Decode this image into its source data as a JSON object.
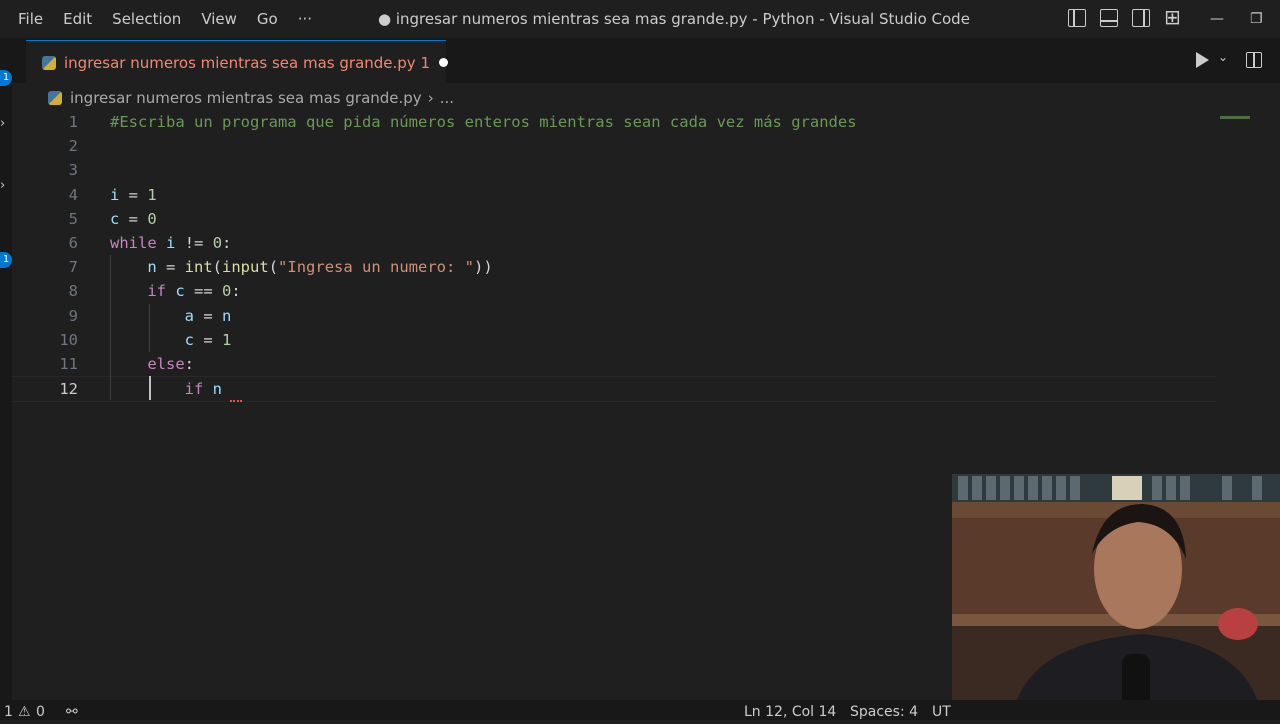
{
  "menu": [
    "File",
    "Edit",
    "Selection",
    "View",
    "Go",
    "···"
  ],
  "window": {
    "title": "● ingresar numeros mientras sea mas grande.py - Python - Visual Studio Code",
    "minimize": "—",
    "restore": "❐"
  },
  "activity_badges": [
    "1",
    "1"
  ],
  "tab": {
    "label": "ingresar numeros mientras sea mas grande.py 1"
  },
  "breadcrumb": {
    "file": "ingresar numeros mientras sea mas grande.py",
    "sep": "›",
    "more": "..."
  },
  "editor": {
    "active_line": 12,
    "lines": [
      {
        "n": "1",
        "segments": [
          {
            "t": "#Escriba un programa que pida números enteros mientras sean cada vez más grandes",
            "c": "cmt"
          }
        ]
      },
      {
        "n": "2",
        "segments": []
      },
      {
        "n": "3",
        "segments": []
      },
      {
        "n": "4",
        "segments": [
          {
            "t": "i",
            "c": "var"
          },
          {
            "t": " = ",
            "c": ""
          },
          {
            "t": "1",
            "c": "num"
          }
        ]
      },
      {
        "n": "5",
        "segments": [
          {
            "t": "c",
            "c": "var"
          },
          {
            "t": " = ",
            "c": ""
          },
          {
            "t": "0",
            "c": "num"
          }
        ]
      },
      {
        "n": "6",
        "segments": [
          {
            "t": "while",
            "c": "kw"
          },
          {
            "t": " ",
            "c": ""
          },
          {
            "t": "i",
            "c": "var"
          },
          {
            "t": " != ",
            "c": ""
          },
          {
            "t": "0",
            "c": "num"
          },
          {
            "t": ":",
            "c": ""
          }
        ]
      },
      {
        "n": "7",
        "segments": [
          {
            "t": "    ",
            "c": ""
          },
          {
            "t": "n",
            "c": "var"
          },
          {
            "t": " = ",
            "c": ""
          },
          {
            "t": "int",
            "c": "fn"
          },
          {
            "t": "(",
            "c": ""
          },
          {
            "t": "input",
            "c": "fn"
          },
          {
            "t": "(",
            "c": ""
          },
          {
            "t": "\"Ingresa un numero: \"",
            "c": "str"
          },
          {
            "t": "))",
            "c": ""
          }
        ]
      },
      {
        "n": "8",
        "segments": [
          {
            "t": "    ",
            "c": ""
          },
          {
            "t": "if",
            "c": "kw"
          },
          {
            "t": " ",
            "c": ""
          },
          {
            "t": "c",
            "c": "var"
          },
          {
            "t": " == ",
            "c": ""
          },
          {
            "t": "0",
            "c": "num"
          },
          {
            "t": ":",
            "c": ""
          }
        ]
      },
      {
        "n": "9",
        "segments": [
          {
            "t": "        ",
            "c": ""
          },
          {
            "t": "a",
            "c": "var"
          },
          {
            "t": " = ",
            "c": ""
          },
          {
            "t": "n",
            "c": "var"
          }
        ]
      },
      {
        "n": "10",
        "segments": [
          {
            "t": "        ",
            "c": ""
          },
          {
            "t": "c",
            "c": "var"
          },
          {
            "t": " = ",
            "c": ""
          },
          {
            "t": "1",
            "c": "num"
          }
        ]
      },
      {
        "n": "11",
        "segments": [
          {
            "t": "    ",
            "c": ""
          },
          {
            "t": "else",
            "c": "kw"
          },
          {
            "t": ":",
            "c": ""
          }
        ]
      },
      {
        "n": "12",
        "segments": [
          {
            "t": "        ",
            "c": ""
          },
          {
            "t": "if",
            "c": "kw"
          },
          {
            "t": " ",
            "c": ""
          },
          {
            "t": "n",
            "c": "var"
          }
        ]
      }
    ]
  },
  "status": {
    "problems_errors": "1",
    "problems_warnings": "0",
    "cursor": "Ln 12, Col 14",
    "spaces": "Spaces: 4",
    "encoding": "UT"
  }
}
